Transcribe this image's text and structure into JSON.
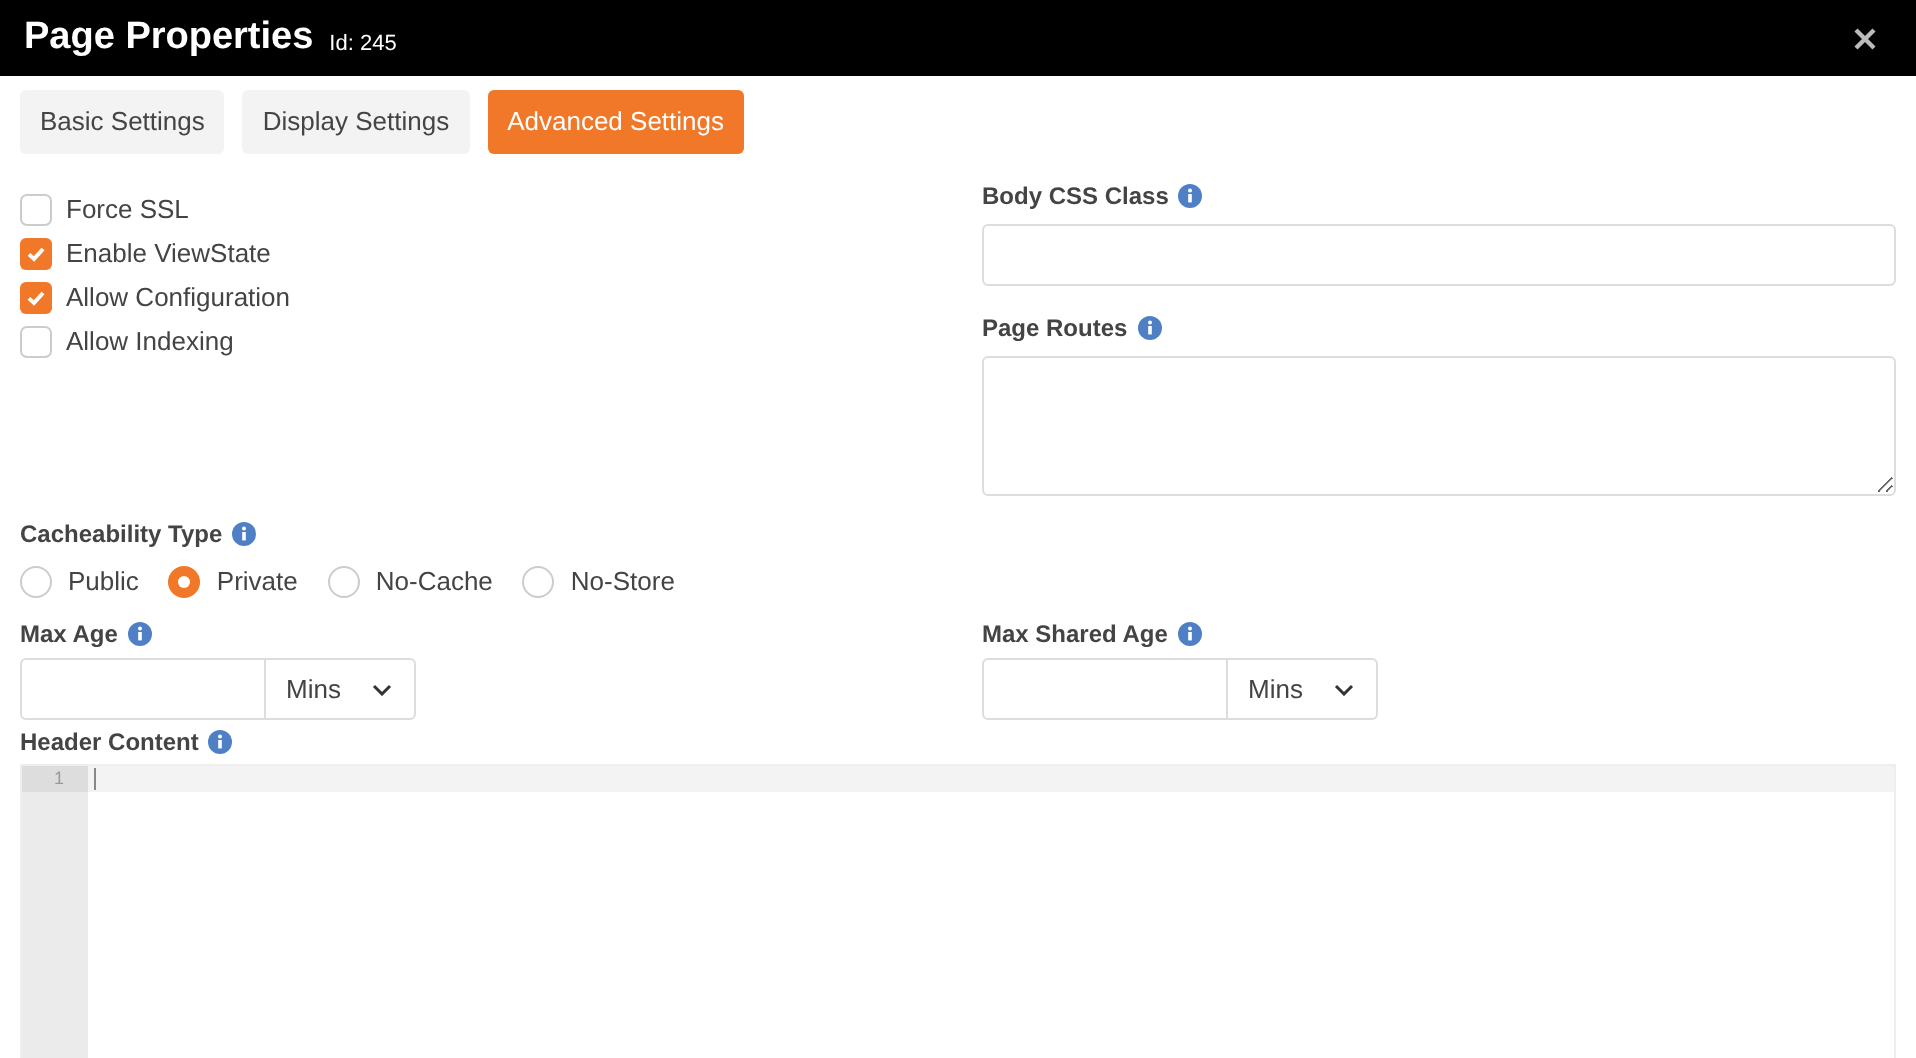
{
  "window": {
    "title": "Page Properties",
    "id_label": "Id: 245"
  },
  "tabs": [
    {
      "label": "Basic Settings",
      "selected": false
    },
    {
      "label": "Display Settings",
      "selected": false
    },
    {
      "label": "Advanced Settings",
      "selected": true
    }
  ],
  "checkboxes": [
    {
      "label": "Force SSL",
      "checked": false
    },
    {
      "label": "Enable ViewState",
      "checked": true
    },
    {
      "label": "Allow Configuration",
      "checked": true
    },
    {
      "label": "Allow Indexing",
      "checked": false
    }
  ],
  "body_css_class": {
    "label": "Body CSS Class"
  },
  "page_routes": {
    "label": "Page Routes"
  },
  "cacheability": {
    "label": "Cacheability Type",
    "options": [
      {
        "label": "Public",
        "selected": false
      },
      {
        "label": "Private",
        "selected": true
      },
      {
        "label": "No-Cache",
        "selected": false
      },
      {
        "label": "No-Store",
        "selected": false
      }
    ]
  },
  "max_age": {
    "label": "Max Age",
    "unit": "Mins"
  },
  "max_shared_age": {
    "label": "Max Shared Age",
    "unit": "Mins"
  },
  "header_content": {
    "label": "Header Content",
    "line_numbers": [
      "1"
    ]
  }
}
